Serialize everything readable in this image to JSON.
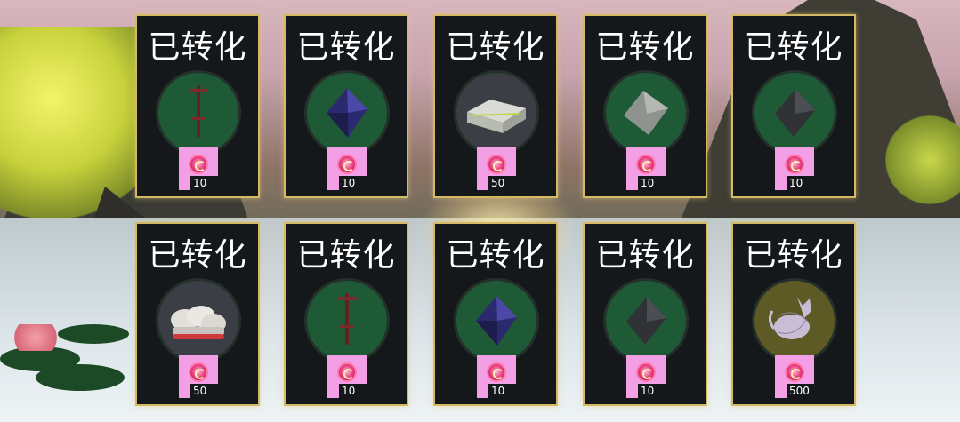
{
  "cards": [
    {
      "status": "已转化",
      "item": "sword-icon",
      "price": "10"
    },
    {
      "status": "已转化",
      "item": "blue-crystal-icon",
      "price": "10"
    },
    {
      "status": "已转化",
      "item": "bed-icon",
      "price": "50"
    },
    {
      "status": "已转化",
      "item": "gray-crystal-icon",
      "price": "10"
    },
    {
      "status": "已转化",
      "item": "dark-crystal-icon",
      "price": "10"
    },
    {
      "status": "已转化",
      "item": "cushion-icon",
      "price": "50"
    },
    {
      "status": "已转化",
      "item": "sword-icon",
      "price": "10"
    },
    {
      "status": "已转化",
      "item": "blue-crystal-icon",
      "price": "10"
    },
    {
      "status": "已转化",
      "item": "dark-crystal-icon",
      "price": "10"
    },
    {
      "status": "已转化",
      "item": "cat-icon",
      "price": "500"
    }
  ],
  "currency_icon": "pink-gem-icon",
  "colors": {
    "card_border": "#d4b964",
    "card_bg": "#15181b",
    "circle_green": "#1f5a36",
    "price_bg": "#f39fe6"
  }
}
